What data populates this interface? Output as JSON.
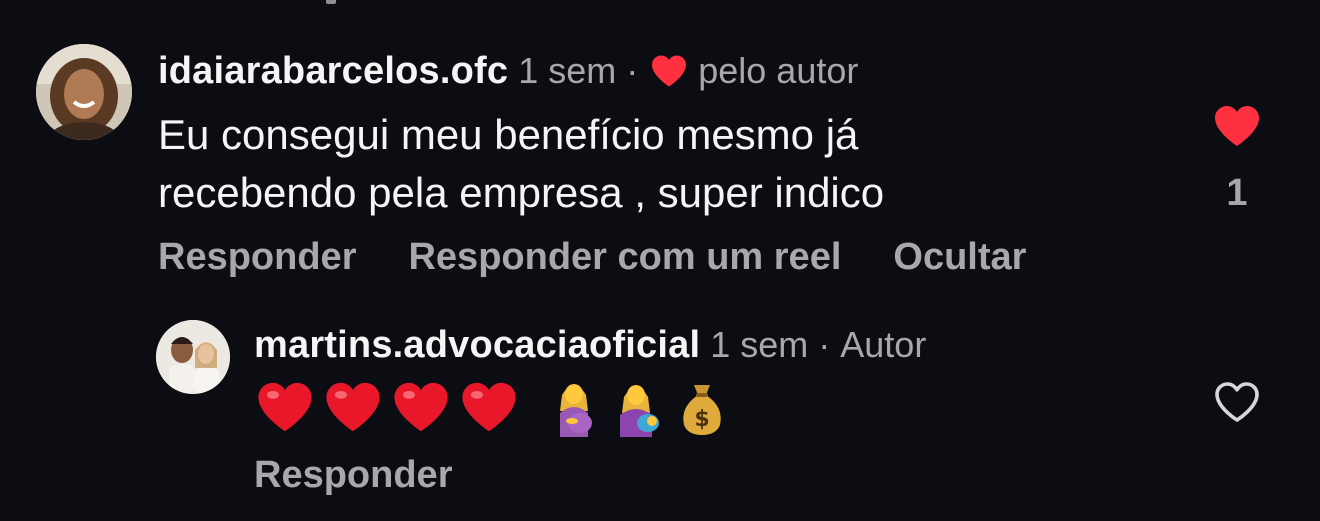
{
  "colors": {
    "background": "#0c0d12",
    "text_primary": "#f5f5f5",
    "text_secondary": "#a7a8ae",
    "like_red": "#ff3040"
  },
  "comment": {
    "username": "idaiarabarcelos.ofc",
    "time": "1 sem",
    "separator": "·",
    "liked_by_author_icon": "heart-icon",
    "liked_by_author_label": "pelo autor",
    "text_line_1": "Eu consegui meu benefício mesmo já",
    "text_line_2": "recebendo pela empresa , super indico",
    "actions": {
      "reply": "Responder",
      "reply_with_reel": "Responder com um reel",
      "hide": "Ocultar"
    },
    "like": {
      "icon": "heart-filled-icon",
      "liked": true,
      "count": "1"
    }
  },
  "reply": {
    "username": "martins.advocaciaoficial",
    "time": "1 sem",
    "separator": "·",
    "author_tag": "Autor",
    "emojis": [
      "red-heart",
      "red-heart",
      "red-heart",
      "red-heart",
      "pregnant-woman",
      "breastfeeding",
      "money-bag"
    ],
    "actions": {
      "reply": "Responder"
    },
    "like": {
      "icon": "heart-outline-icon",
      "liked": false
    }
  }
}
